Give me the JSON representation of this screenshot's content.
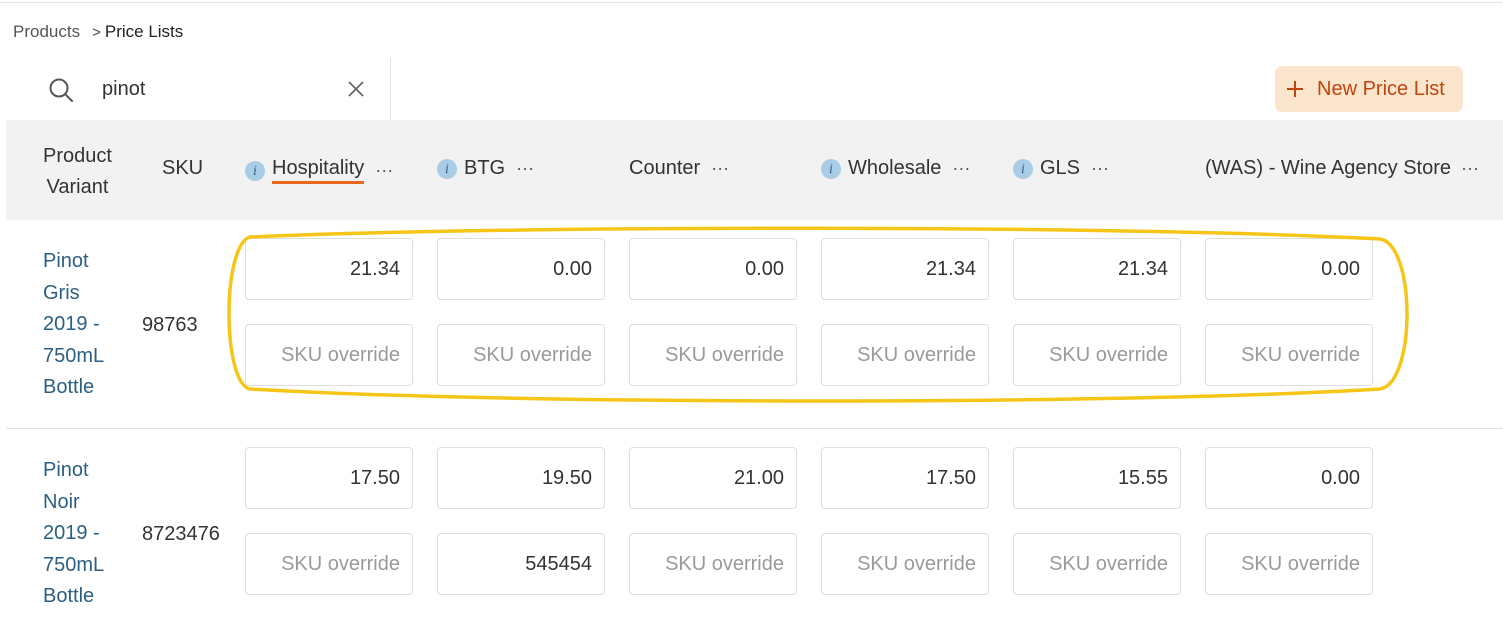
{
  "breadcrumb": {
    "parent": "Products",
    "separator": ">",
    "current": "Price Lists"
  },
  "search": {
    "value": "pinot",
    "icon": "search-icon",
    "clear_icon": "close-icon"
  },
  "toolbar": {
    "new_label": "New Price List",
    "accent": "#c1440e",
    "button_bg": "#fbe5cc"
  },
  "table": {
    "columns": {
      "product_line1": "Product",
      "product_line2": "Variant",
      "sku": "SKU",
      "price_lists": [
        {
          "label": "Hospitality",
          "info": true,
          "active": true,
          "menu": "···"
        },
        {
          "label": "BTG",
          "info": true,
          "menu": "···"
        },
        {
          "label": "Counter",
          "info": false,
          "menu": "···"
        },
        {
          "label": "Wholesale",
          "info": true,
          "menu": "···"
        },
        {
          "label": "GLS",
          "info": true,
          "menu": "···"
        },
        {
          "label": "(WAS) - Wine Agency Store",
          "info": false,
          "menu": "···"
        }
      ]
    },
    "rows": [
      {
        "name_lines": [
          "Pinot",
          "Gris",
          "2019 -",
          "750mL",
          "Bottle"
        ],
        "sku": "98763",
        "prices": [
          "21.34",
          "0.00",
          "0.00",
          "21.34",
          "21.34",
          "0.00"
        ],
        "overrides": [
          "",
          "",
          "",
          "",
          "",
          ""
        ],
        "override_placeholder": "SKU override"
      },
      {
        "name_lines": [
          "Pinot",
          "Noir",
          "2019 -",
          "750mL",
          "Bottle"
        ],
        "sku": "8723476",
        "prices": [
          "17.50",
          "19.50",
          "21.00",
          "17.50",
          "15.55",
          "0.00"
        ],
        "overrides": [
          "",
          "545454",
          "",
          "",
          "",
          ""
        ],
        "override_placeholder": "SKU override"
      }
    ]
  },
  "colors": {
    "link": "#2c5f82",
    "highlight": "#f5c518",
    "active_underline": "#e8671c",
    "info_icon": "#a9cde6"
  }
}
